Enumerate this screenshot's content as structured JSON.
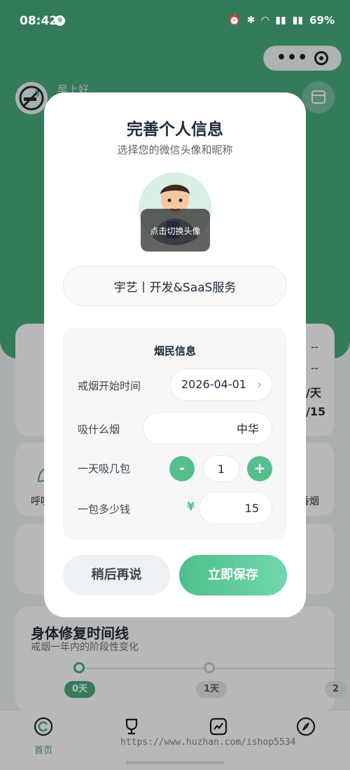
{
  "status_bar": {
    "time": "08:42",
    "badge": "9",
    "battery": "69%"
  },
  "background": {
    "greeting": "早上好",
    "card1_values": [
      "--",
      "--"
    ],
    "card1_side_a": "/天",
    "card1_side_b": "/15",
    "card2_left": "呼吸",
    "card2_right": "香烟",
    "timeline": {
      "title": "身体修复时间线",
      "subtitle": "戒烟一年内的阶段性变化",
      "stages": [
        "0天",
        "1天",
        "2"
      ]
    }
  },
  "modal": {
    "title": "完善个人信息",
    "subtitle": "选择您的微信头像和昵称",
    "avatar_caption": "点击切换头像",
    "nickname": "宇艺丨开发&SaaS服务",
    "panel_title": "烟民信息",
    "rows": {
      "quit_date_label": "戒烟开始时间",
      "quit_date_value": "2026-04-01",
      "brand_label": "吸什么烟",
      "brand_value": "中华",
      "packs_label": "一天吸几包",
      "packs_value": "1",
      "price_label": "一包多少钱",
      "currency": "¥",
      "price_value": "15"
    },
    "minus": "-",
    "plus": "+",
    "later_button": "稍后再说",
    "save_button": "立即保存"
  },
  "tabbar": {
    "tabs": [
      {
        "label": "首页",
        "icon": "home-icon",
        "active": true
      },
      {
        "label": "",
        "icon": "trophy-icon",
        "active": false
      },
      {
        "label": "",
        "icon": "chart-icon",
        "active": false
      },
      {
        "label": "",
        "icon": "compass-icon",
        "active": false
      }
    ]
  },
  "watermark": "https://www.huzhan.com/ishop5534",
  "colors": {
    "accent": "#48ab7d",
    "button_green": "#56bd8d",
    "overlay": "rgba(0,0,0,0.28)"
  }
}
